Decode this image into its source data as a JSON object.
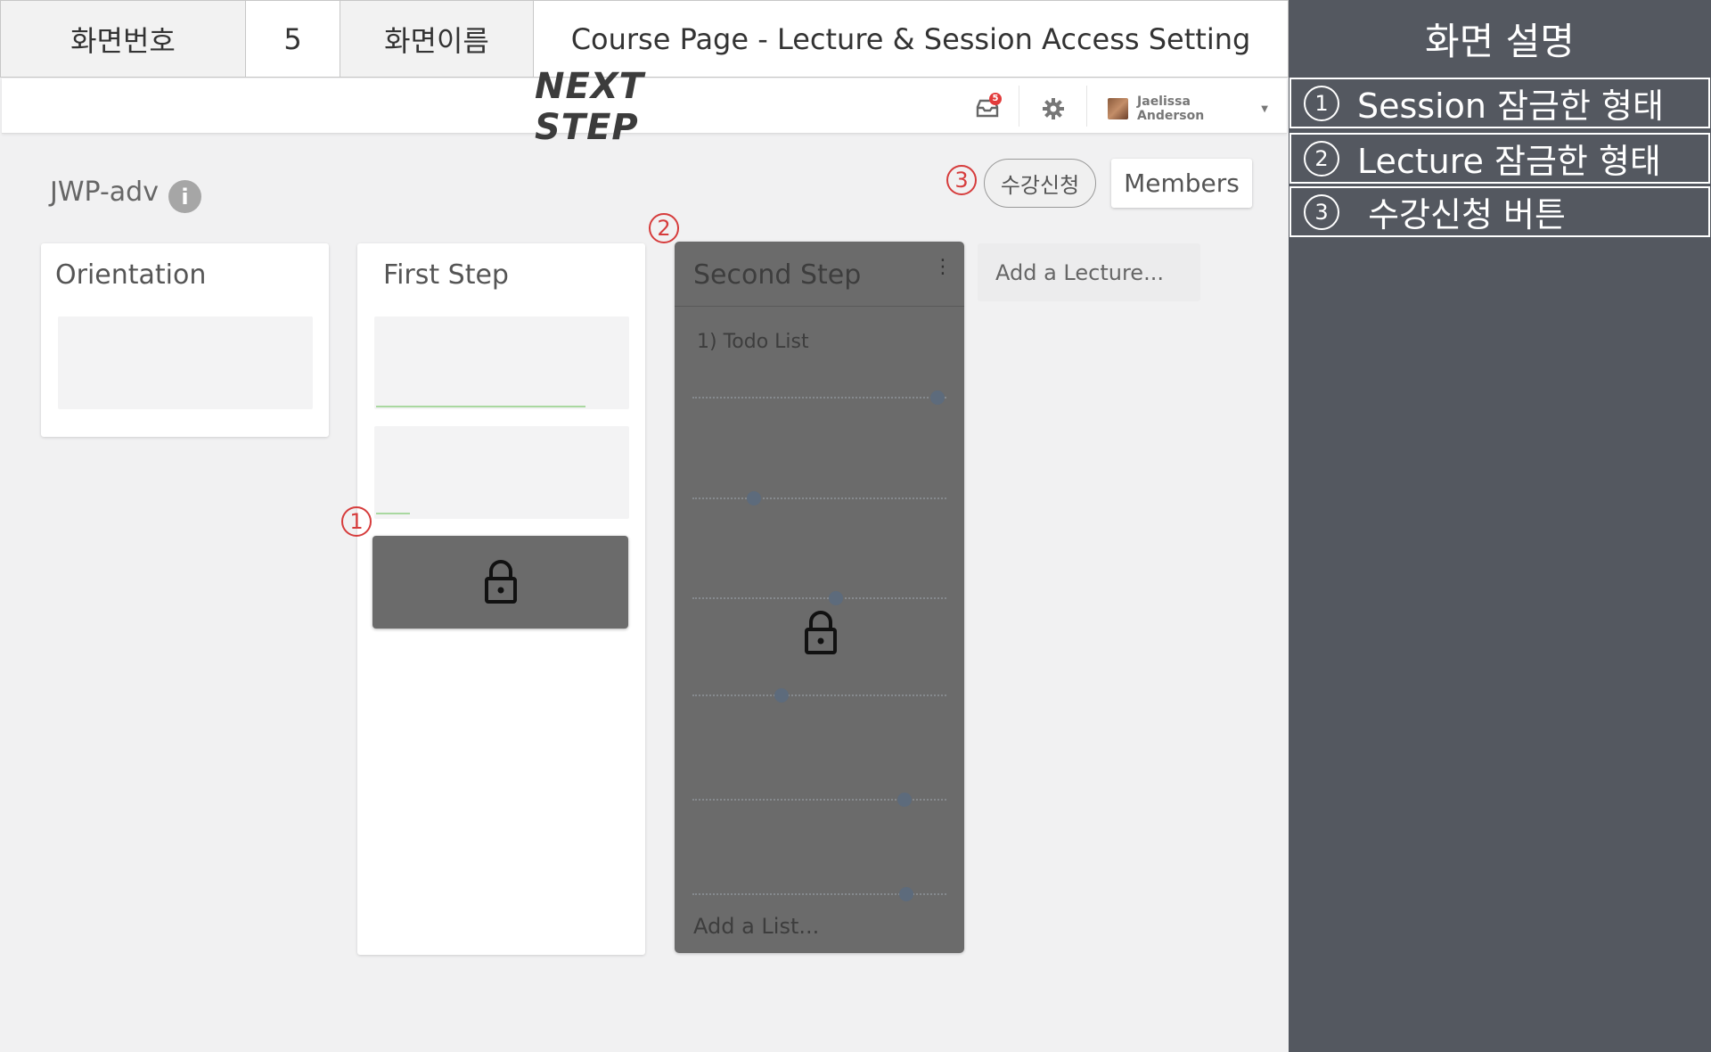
{
  "header": {
    "screen_number_label": "화면번호",
    "screen_number": "5",
    "screen_name_label": "화면이름",
    "screen_name": "Course Page - Lecture & Session Access Setting"
  },
  "description": {
    "title": "화면 설명",
    "items": [
      {
        "num": "1",
        "text": "Session 잠금한 형태"
      },
      {
        "num": "2",
        "text": "Lecture 잠금한 형태"
      },
      {
        "num": "3",
        "text": " 수강신청 버튼"
      }
    ]
  },
  "navbar": {
    "logo": "NEXT STEP",
    "notification_count": "5",
    "user_name": "Jaelissa Anderson"
  },
  "course": {
    "title": "JWP-adv",
    "enroll_button": "수강신청",
    "members_button": "Members"
  },
  "lectures": [
    {
      "title": "Orientation"
    },
    {
      "title": "First Step"
    },
    {
      "title": "Second Step",
      "list_title": "1) Todo List",
      "add_list": "Add a List..."
    }
  ],
  "add_lecture": "Add a Lecture...",
  "markers": [
    "1",
    "2",
    "3"
  ],
  "colors": {
    "panel_bg": "#545860",
    "marker_red": "#d63c3c",
    "locked_overlay": "#6b6b6b",
    "progress_green": "#a9d8a0"
  }
}
